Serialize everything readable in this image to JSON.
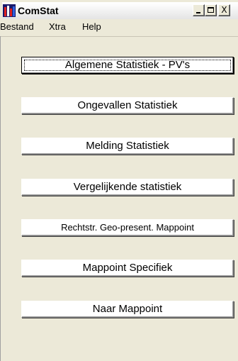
{
  "window": {
    "title": "ComStat",
    "minimize_label": "_",
    "close_label": "X"
  },
  "menu": {
    "items": [
      "Bestand",
      "Xtra",
      "Help"
    ]
  },
  "buttons": [
    {
      "label": "Algemene Statistiek - PV's",
      "focused": true
    },
    {
      "label": "Ongevallen Statistiek"
    },
    {
      "label": "Melding Statistiek"
    },
    {
      "label": "Vergelijkende statistiek"
    },
    {
      "label": "Rechtstr. Geo-present. Mappoint"
    },
    {
      "label": "Mappoint Specifiek"
    },
    {
      "label": "Naar Mappoint"
    }
  ]
}
